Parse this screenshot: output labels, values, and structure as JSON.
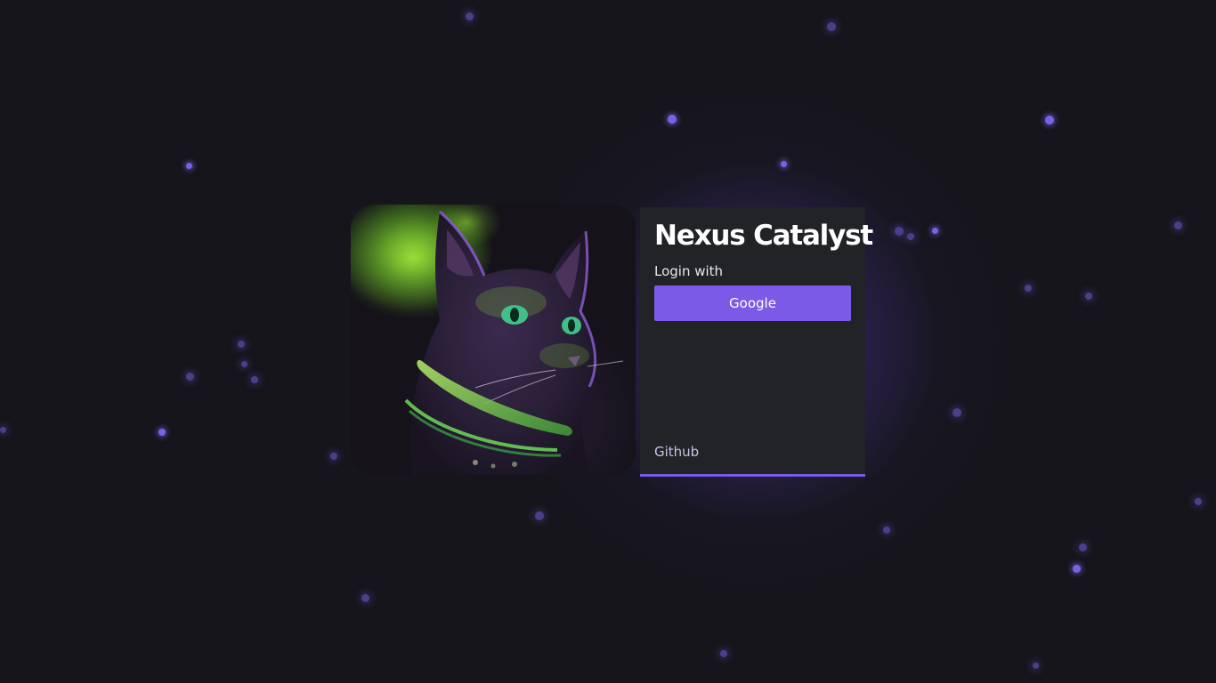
{
  "app": {
    "title": "Nexus Catalyst"
  },
  "login": {
    "prompt": "Login with",
    "google_label": "Google"
  },
  "footer": {
    "github_label": "Github"
  },
  "hero": {
    "image_description": "neon-cat-illustration"
  },
  "colors": {
    "accent": "#7b5ae8",
    "background": "#16151b",
    "card": "#222327",
    "particle": "#7a62e8"
  }
}
